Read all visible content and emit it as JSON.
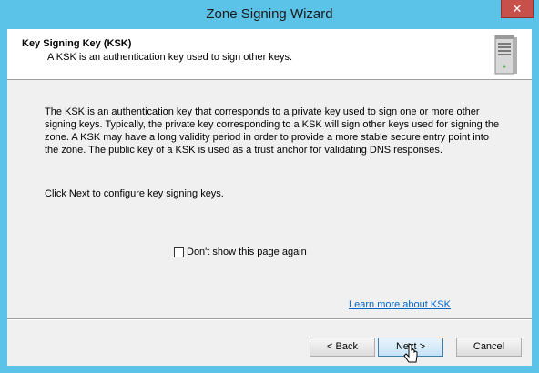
{
  "window": {
    "title": "Zone Signing Wizard",
    "close_glyph": "✕"
  },
  "header": {
    "title": "Key Signing Key (KSK)",
    "subtitle": "A KSK is an authentication key used to sign other keys.",
    "icon": "server-icon"
  },
  "body": {
    "description": "The KSK is an authentication key that corresponds to a private key used to sign one or more other signing keys. Typically, the private key corresponding to a KSK will sign other keys used for signing the zone. A KSK may have a long validity period in order to provide a more stable secure entry point into the zone. The public key of a KSK is used as a trust anchor for validating DNS responses.",
    "instruction": "Click Next to configure key signing keys.",
    "checkbox_label": "Don't show this page again",
    "checkbox_checked": false,
    "learn_more": "Learn more about KSK"
  },
  "buttons": {
    "back": "< Back",
    "next": "Next >",
    "cancel": "Cancel"
  }
}
